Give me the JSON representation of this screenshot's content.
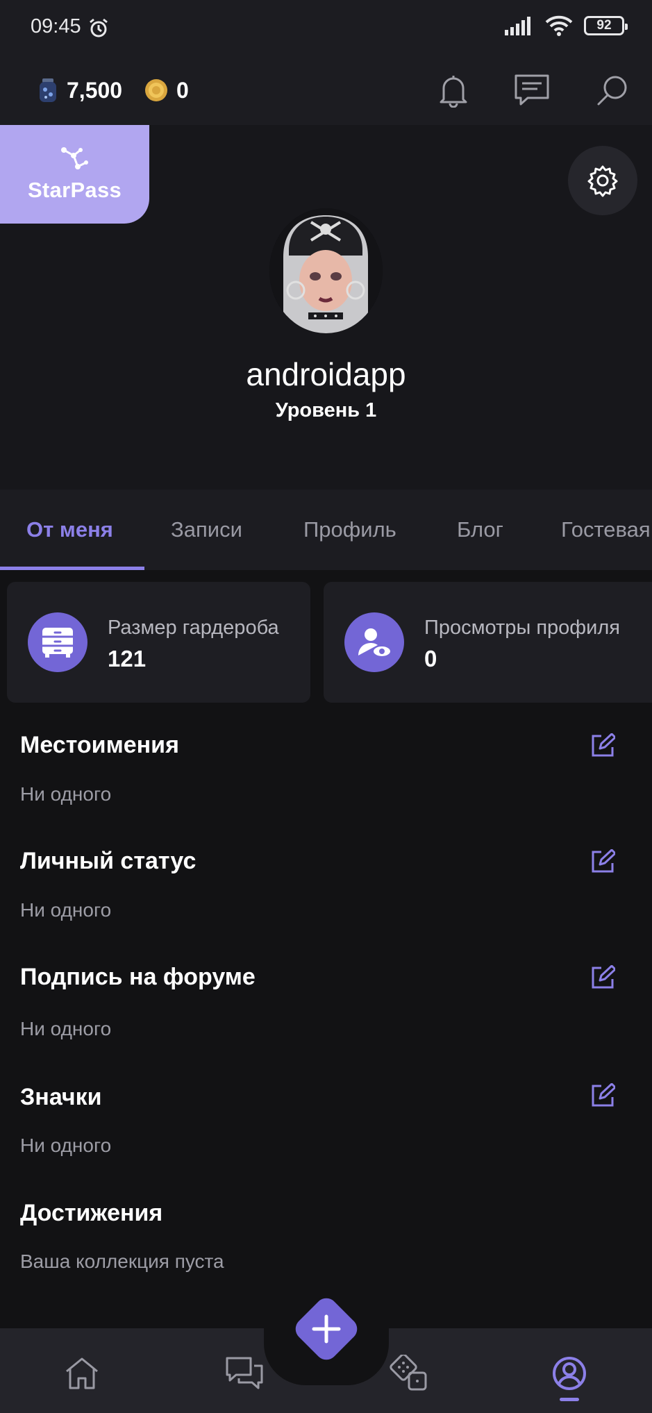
{
  "status_bar": {
    "time": "09:45",
    "battery": "92"
  },
  "top_bar": {
    "gems": "7,500",
    "coins": "0"
  },
  "starpass": {
    "label": "StarPass"
  },
  "profile": {
    "username": "androidapp",
    "level": "Уровень 1"
  },
  "tabs": [
    {
      "label": "От меня",
      "active": true
    },
    {
      "label": "Записи"
    },
    {
      "label": "Профиль"
    },
    {
      "label": "Блог"
    },
    {
      "label": "Гостевая"
    }
  ],
  "stats": [
    {
      "label": "Размер гардероба",
      "value": "121",
      "icon": "dresser-icon"
    },
    {
      "label": "Просмотры профиля",
      "value": "0",
      "icon": "profile-views-icon"
    }
  ],
  "sections": [
    {
      "title": "Местоимения",
      "value": "Ни одного",
      "editable": true
    },
    {
      "title": "Личный статус",
      "value": "Ни одного",
      "editable": true
    },
    {
      "title": "Подпись на форуме",
      "value": "Ни одного",
      "editable": true
    },
    {
      "title": "Значки",
      "value": "Ни одного",
      "editable": true
    },
    {
      "title": "Достижения",
      "value": "Ваша коллекция пуста",
      "editable": false
    }
  ],
  "bottom_nav": [
    {
      "icon": "home-icon"
    },
    {
      "icon": "chat-icon"
    },
    {
      "icon": "dice-icon"
    },
    {
      "icon": "profile-icon",
      "active": true
    }
  ],
  "colors": {
    "accent": "#8c80e8",
    "starpass": "#b1a6f0",
    "background": "#121214",
    "card": "#1e1e23"
  }
}
